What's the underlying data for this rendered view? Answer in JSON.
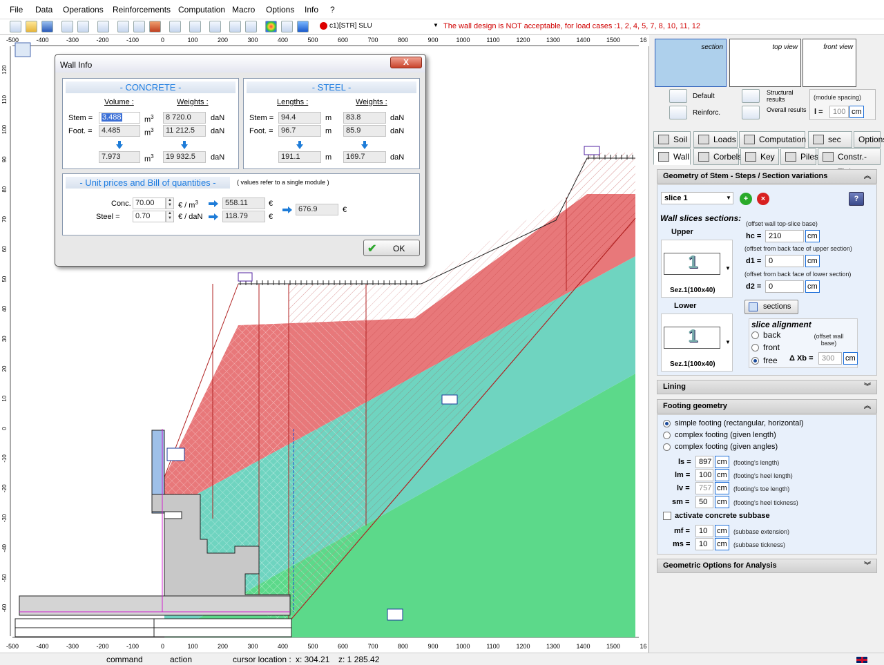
{
  "menu": [
    "File",
    "Data",
    "Operations",
    "Reinforcements",
    "Computation",
    "Macro",
    "Options",
    "Info",
    "?"
  ],
  "toolbar": {
    "load_case": "c1)[STR] SLU",
    "warning": "The wall design is NOT acceptable, for load cases  :1, 2, 4, 5, 7, 8, 10, 11, 12"
  },
  "ruler": {
    "top": [
      "-500",
      "-400",
      "-300",
      "-200",
      "-100",
      "0",
      "100",
      "200",
      "300",
      "400",
      "500",
      "600",
      "700",
      "800",
      "900",
      "1000",
      "1100",
      "1200",
      "1300",
      "1400",
      "1500",
      "16"
    ],
    "bottom": [
      "-500",
      "-400",
      "-300",
      "-200",
      "-100",
      "0",
      "100",
      "200",
      "300",
      "400",
      "500",
      "600",
      "700",
      "800",
      "900",
      "1000",
      "1100",
      "1200",
      "1300",
      "1400",
      "1500",
      "16"
    ],
    "left": [
      "120",
      "110",
      "100",
      "90",
      "80",
      "70",
      "60",
      "50",
      "40",
      "30",
      "20",
      "10",
      "0",
      "-10",
      "-20",
      "-30",
      "-40",
      "-50",
      "-60"
    ]
  },
  "dialog": {
    "title": "Wall Info",
    "close": "X",
    "concrete": {
      "title": "- CONCRETE -",
      "volume_label": "Volume :",
      "weights_label": "Weights :",
      "stem_label": "Stem =",
      "foot_label": "Foot. =",
      "stem_volume": "3.488",
      "foot_volume": "4.485",
      "total_volume": "7.973",
      "stem_weight": "8 720.0",
      "foot_weight": "11 212.5",
      "total_weight": "19 932.5",
      "unit_m3": "m",
      "unit_exp": "3",
      "unit_dan": "daN"
    },
    "steel": {
      "title": "- STEEL -",
      "lengths_label": "Lengths :",
      "weights_label": "Weights :",
      "stem_label": "Stem =",
      "foot_label": "Foot. =",
      "stem_length": "94.4",
      "foot_length": "96.7",
      "total_length": "191.1",
      "stem_weight": "83.8",
      "foot_weight": "85.9",
      "total_weight": "169.7",
      "unit_m": "m",
      "unit_dan": "daN"
    },
    "bill": {
      "title": "- Unit prices and Bill of quantities -",
      "note": "( values refer to a single module )",
      "conc_label": "Conc.",
      "conc_price": "70.00",
      "conc_unit": "€ / m",
      "conc_unit_exp": "3",
      "conc_total": "558.11",
      "steel_label": "Steel =",
      "steel_price": "0.70",
      "steel_unit": "€ / daN",
      "steel_total": "118.79",
      "euro": "€",
      "grand_total": "676.9"
    },
    "ok": "OK"
  },
  "right_panel": {
    "views": {
      "section": "section",
      "top": "top view",
      "front": "front view"
    },
    "display": {
      "default": "Default",
      "reinforc": "Reinforc.",
      "structural": "Structural results",
      "overall": "Overall results",
      "module_spacing": "(module spacing)",
      "l_label": "l =",
      "l_value": "100",
      "l_unit": "cm"
    },
    "tabs_row1": [
      "Soil",
      "Loads",
      "Computation",
      "sec",
      "Options"
    ],
    "tabs_row2": [
      "Wall",
      "Corbels",
      "Key",
      "Piles",
      "Constr.-Tieb."
    ],
    "geometry": {
      "header": "Geometry of Stem - Steps / Section variations",
      "slice": "slice 1",
      "slices_title": "Wall slices sections:",
      "upper": "Upper",
      "lower": "Lower",
      "section_name": "Sez.1(100x40)",
      "section_glyph": "1",
      "hc_note": "(offset wall top-slice base)",
      "hc_label": "hc =",
      "hc_value": "210",
      "d1_note": "(offset from back face of upper section)",
      "d1_label": "d1 =",
      "d1_value": "0",
      "d2_note": "(offset from back face of lower section)",
      "d2_label": "d2 =",
      "d2_value": "0",
      "unit": "cm",
      "sections_btn": "sections",
      "alignment_title": "slice alignment",
      "align_back": "back",
      "align_front": "front",
      "align_free": "free",
      "offset_note": "(offset wall base)",
      "dxb_label": "Δ Xb =",
      "dxb_value": "300"
    },
    "lining": "Lining",
    "footing": {
      "header": "Footing geometry",
      "opt1": "simple footing (rectangular, horizontal)",
      "opt2": "complex footing (given length)",
      "opt3": "complex footing (given angles)",
      "ls_label": "ls =",
      "ls_value": "897",
      "ls_note": "(footing's length)",
      "lm_label": "lm =",
      "lm_value": "100",
      "lm_note": "(footing's heel length)",
      "lv_label": "lv =",
      "lv_value": "757",
      "lv_note": "(footing's toe length)",
      "sm_label": "sm =",
      "sm_value": "50",
      "sm_note": "(footing's heel tickness)",
      "subbase": "activate concrete subbase",
      "mf_label": "mf =",
      "mf_value": "10",
      "mf_note": "(subbase extension)",
      "ms_label": "ms =",
      "ms_value": "10",
      "ms_note": "(subbase tickness)",
      "unit": "cm"
    },
    "geo_options": "Geometric Options for Analysis"
  },
  "status": {
    "command": "command",
    "action": "action",
    "cursor_label": "cursor location :",
    "cursor_x": "x: 304.21",
    "cursor_z": "z: 1 285.42"
  },
  "colors": {
    "soil_red": "#e8787a",
    "soil_teal": "#6fd4c0",
    "soil_green": "#5cd98a",
    "accent_blue": "#1e7cd8",
    "warning_red": "#d00000"
  }
}
